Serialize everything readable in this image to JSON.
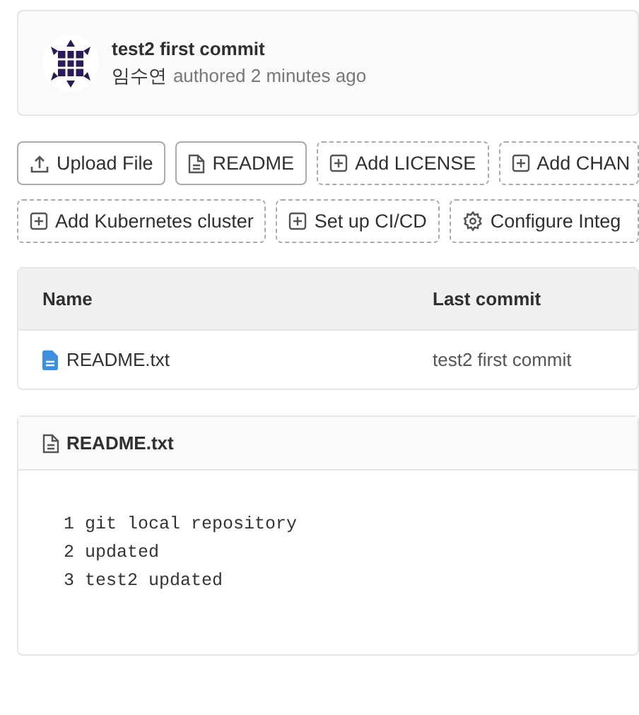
{
  "commit": {
    "title": "test2 first commit",
    "author": "임수연",
    "meta": "authored 2 minutes ago"
  },
  "actions": [
    [
      {
        "label": "Upload File",
        "kind": "upload"
      },
      {
        "label": "README",
        "kind": "file"
      },
      {
        "label": "Add LICENSE",
        "kind": "add"
      },
      {
        "label": "Add CHAN",
        "kind": "add"
      }
    ],
    [
      {
        "label": "Add Kubernetes cluster",
        "kind": "add"
      },
      {
        "label": "Set up CI/CD",
        "kind": "add"
      },
      {
        "label": "Configure Integ",
        "kind": "settings"
      }
    ]
  ],
  "table": {
    "columns": [
      "Name",
      "Last commit"
    ],
    "rows": [
      {
        "name": "README.txt",
        "last_commit": "test2 first commit"
      }
    ]
  },
  "readme": {
    "title": "README.txt",
    "lines": [
      "1 git local repository",
      "2 updated",
      "3 test2 updated"
    ]
  }
}
